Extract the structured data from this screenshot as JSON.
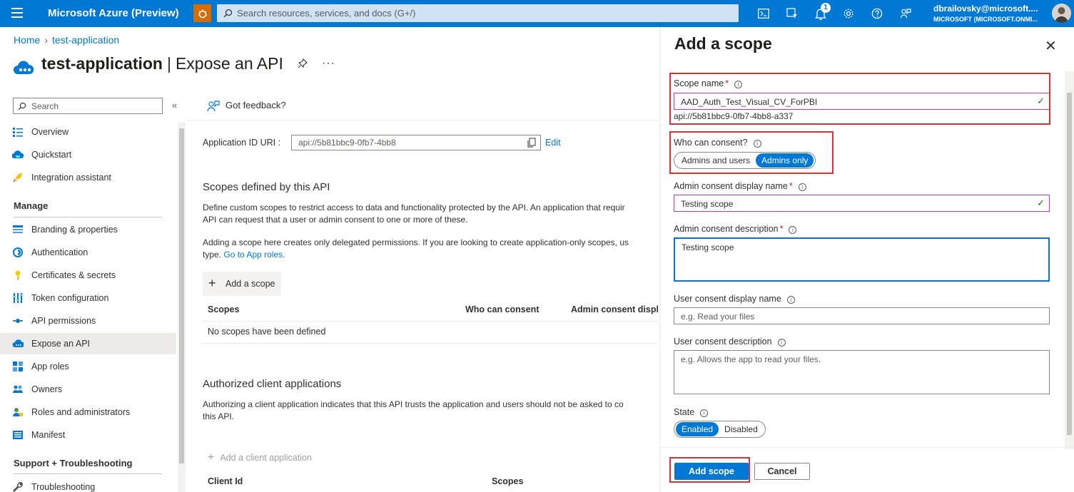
{
  "topbar": {
    "brand": "Microsoft Azure (Preview)",
    "search_placeholder": "Search resources, services, and docs (G+/)",
    "notification_count": "1",
    "user_name": "dbrailovsky@microsoft....",
    "user_tenant": "MICROSOFT (MICROSOFT.ONMI..."
  },
  "breadcrumb": {
    "home": "Home",
    "app": "test-application"
  },
  "title": {
    "app": "test-application",
    "page": "Expose an API"
  },
  "nav": {
    "search_placeholder": "Search",
    "items_top": [
      {
        "label": "Overview",
        "icon": "overview-icon"
      },
      {
        "label": "Quickstart",
        "icon": "quickstart-icon"
      },
      {
        "label": "Integration assistant",
        "icon": "rocket-icon"
      }
    ],
    "manage_label": "Manage",
    "manage_items": [
      {
        "label": "Branding & properties",
        "icon": "branding-icon"
      },
      {
        "label": "Authentication",
        "icon": "authentication-icon"
      },
      {
        "label": "Certificates & secrets",
        "icon": "key-icon"
      },
      {
        "label": "Token configuration",
        "icon": "token-icon"
      },
      {
        "label": "API permissions",
        "icon": "api-permissions-icon"
      },
      {
        "label": "Expose an API",
        "icon": "cloud-icon",
        "active": true
      },
      {
        "label": "App roles",
        "icon": "app-roles-icon"
      },
      {
        "label": "Owners",
        "icon": "owners-icon"
      },
      {
        "label": "Roles and administrators",
        "icon": "roles-icon"
      },
      {
        "label": "Manifest",
        "icon": "manifest-icon"
      }
    ],
    "support_label": "Support + Troubleshooting",
    "support_items": [
      {
        "label": "Troubleshooting",
        "icon": "wrench-icon"
      }
    ]
  },
  "main": {
    "feedback": "Got feedback?",
    "app_id_label": "Application ID URI :",
    "app_id_value": "api://5b81bbc9-0fb7-4bb8",
    "edit": "Edit",
    "scopes_title": "Scopes defined by this API",
    "scopes_desc_1": "Define custom scopes to restrict access to data and functionality protected by the API. An application that requir",
    "scopes_desc_2": "API can request that a user or admin consent to one or more of these.",
    "scopes_desc_3": "Adding a scope here creates only delegated permissions. If you are looking to create application-only scopes, us",
    "scopes_desc_4_prefix": "type. ",
    "scopes_desc_4_link": "Go to App roles.",
    "add_scope": "Add a scope",
    "scopes_headers": [
      "Scopes",
      "Who can consent",
      "Admin consent displa"
    ],
    "no_scopes": "No scopes have been defined",
    "clients_title": "Authorized client applications",
    "clients_desc_1": "Authorizing a client application indicates that this API trusts the application and users should not be asked to co",
    "clients_desc_2": "this API.",
    "add_client": "Add a client application",
    "client_headers": [
      "Client Id",
      "Scopes"
    ]
  },
  "panel": {
    "title": "Add a scope",
    "scope_name_label": "Scope name",
    "scope_name_value": "AAD_Auth_Test_Visual_CV_ForPBI",
    "scope_uri": "api://5b81bbc9-0fb7-4bb8-a337",
    "who_consent_label": "Who can consent?",
    "who_consent_options": [
      "Admins and users",
      "Admins only"
    ],
    "who_consent_selected": "Admins only",
    "admin_display_label": "Admin consent display name",
    "admin_display_value": "Testing scope",
    "admin_desc_label": "Admin consent description",
    "admin_desc_value": "Testing scope",
    "user_display_label": "User consent display name",
    "user_display_placeholder": "e.g. Read your files",
    "user_desc_label": "User consent description",
    "user_desc_placeholder": "e.g. Allows the app to read your files.",
    "state_label": "State",
    "state_options": [
      "Enabled",
      "Disabled"
    ],
    "state_selected": "Enabled",
    "add_button": "Add scope",
    "cancel_button": "Cancel"
  },
  "colors": {
    "accent": "#0078d4",
    "highlight": "#d13438",
    "success": "#107c10"
  }
}
